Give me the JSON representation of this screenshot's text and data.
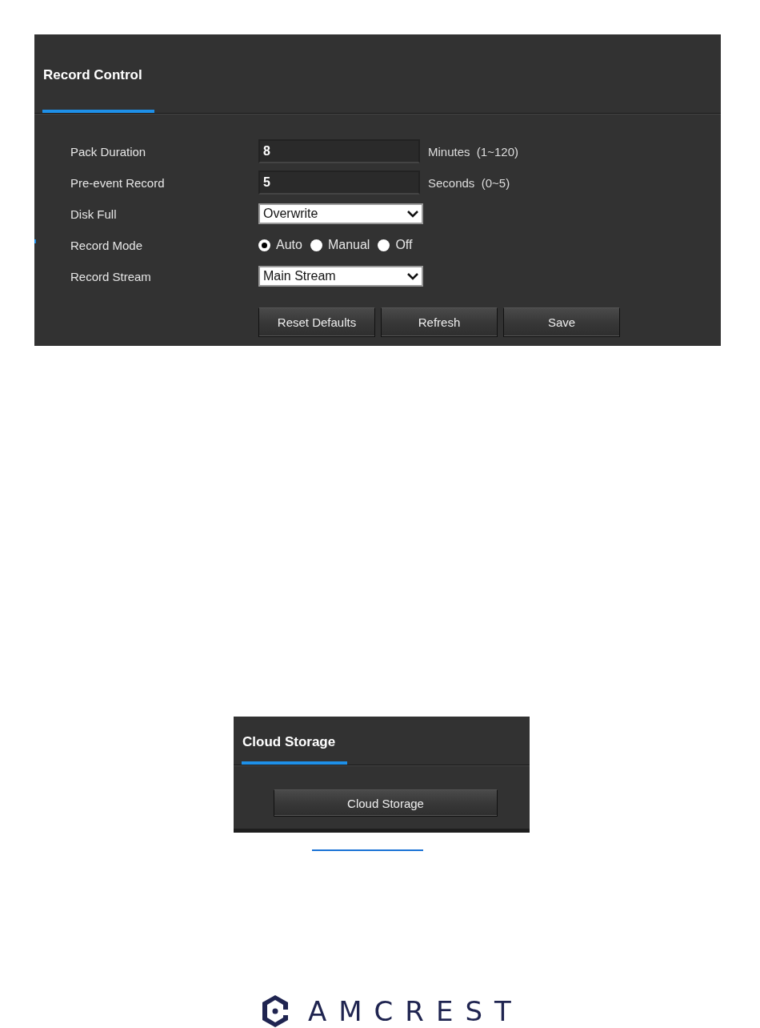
{
  "record_control": {
    "tab": {
      "label": "Record Control",
      "selected": true
    },
    "rows": [
      {
        "kind": "text",
        "label": "Pack Duration",
        "value": "8",
        "hint": "Minutes  (1~120)"
      },
      {
        "kind": "text",
        "label": "Pre-event Record",
        "value": "5",
        "hint": "Seconds  (0~5)"
      },
      {
        "kind": "select",
        "label": "Disk Full",
        "value": "Overwrite"
      },
      {
        "kind": "radio",
        "label": "Record Mode",
        "options": [
          {
            "label": "Auto",
            "selected": true
          },
          {
            "label": "Manual",
            "selected": false
          },
          {
            "label": "Off",
            "selected": false
          }
        ]
      },
      {
        "kind": "select",
        "label": "Record Stream",
        "value": "Main Stream"
      }
    ],
    "buttons": [
      "Reset Defaults",
      "Refresh",
      "Save"
    ]
  },
  "cloud_storage": {
    "tab": {
      "label": "Cloud Storage",
      "selected": true
    },
    "button": "Cloud Storage"
  },
  "logo": {
    "text": "AMCREST"
  }
}
